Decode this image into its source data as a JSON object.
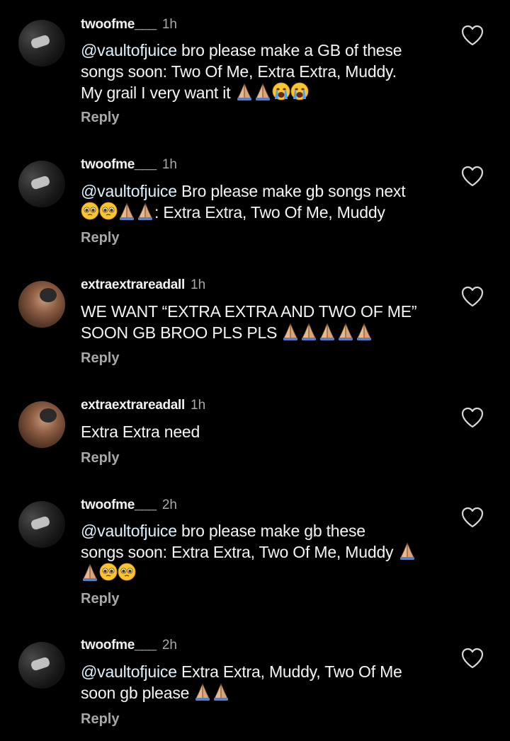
{
  "comments": [
    {
      "username": "twoofme___",
      "time": "1h",
      "mention": "@vaultofjuice",
      "line1_rest": " bro please make a GB of these",
      "line2": "songs soon: Two Of Me, Extra Extra, Muddy.",
      "line3": "My grail I very want it ",
      "emojis": [
        "folded-hands-icon",
        "folded-hands-icon",
        "crying-face-icon",
        "crying-face-icon"
      ],
      "reply_label": "Reply"
    },
    {
      "username": "twoofme___",
      "time": "1h",
      "mention": "@vaultofjuice",
      "line1_rest": " Bro please make gb songs next",
      "line2_after_emoji": ": Extra Extra, Two Of Me, Muddy",
      "emojis": [
        "pleading-face-icon",
        "pleading-face-icon",
        "folded-hands-icon",
        "folded-hands-icon"
      ],
      "reply_label": "Reply"
    },
    {
      "username": "extraextrareadall",
      "time": "1h",
      "line1": "WE WANT “EXTRA EXTRA AND TWO OF ME”",
      "line2": "SOON GB BROO PLS PLS ",
      "emojis": [
        "folded-hands-icon",
        "folded-hands-icon",
        "folded-hands-icon",
        "folded-hands-icon",
        "folded-hands-icon"
      ],
      "reply_label": "Reply"
    },
    {
      "username": "extraextrareadall",
      "time": "1h",
      "line1": "Extra Extra need",
      "reply_label": "Reply"
    },
    {
      "username": "twoofme___",
      "time": "2h",
      "mention": "@vaultofjuice",
      "line1_rest": " bro please make gb these",
      "line2": "songs soon: Extra Extra, Two Of Me, Muddy ",
      "emojis": [
        "folded-hands-icon",
        "folded-hands-icon",
        "pleading-face-icon",
        "pleading-face-icon"
      ],
      "reply_label": "Reply"
    },
    {
      "username": "twoofme___",
      "time": "2h",
      "mention": "@vaultofjuice",
      "line1_rest": " Extra Extra, Muddy, Two Of Me",
      "line2": "soon gb please ",
      "emojis": [
        "folded-hands-icon",
        "folded-hands-icon"
      ],
      "reply_label": "Reply"
    }
  ],
  "colors": {
    "background": "#000000",
    "text": "#f5f5f5",
    "secondary": "#a8a8a8"
  }
}
